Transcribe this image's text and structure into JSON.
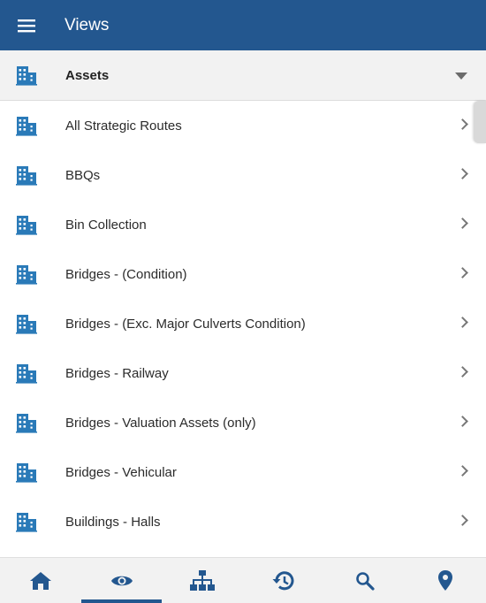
{
  "app_bar": {
    "title": "Views",
    "menu_icon": "hamburger-menu-icon",
    "color": "#23578f"
  },
  "section": {
    "title": "Assets",
    "icon": "building-icon",
    "expanded": true
  },
  "items": [
    {
      "label": "All Strategic Routes"
    },
    {
      "label": "BBQs"
    },
    {
      "label": "Bin Collection"
    },
    {
      "label": "Bridges - (Condition)"
    },
    {
      "label": "Bridges - (Exc. Major Culverts Condition)"
    },
    {
      "label": "Bridges - Railway"
    },
    {
      "label": "Bridges - Valuation Assets (only)"
    },
    {
      "label": "Bridges - Vehicular"
    },
    {
      "label": "Buildings - Halls"
    }
  ],
  "bottom_nav": [
    {
      "icon": "home-icon",
      "active": false
    },
    {
      "icon": "eye-icon",
      "active": true
    },
    {
      "icon": "hierarchy-icon",
      "active": false
    },
    {
      "icon": "history-icon",
      "active": false
    },
    {
      "icon": "search-icon",
      "active": false
    },
    {
      "icon": "map-pin-icon",
      "active": false
    }
  ],
  "colors": {
    "accent": "#23578f",
    "icon": "#2a7ab8"
  }
}
